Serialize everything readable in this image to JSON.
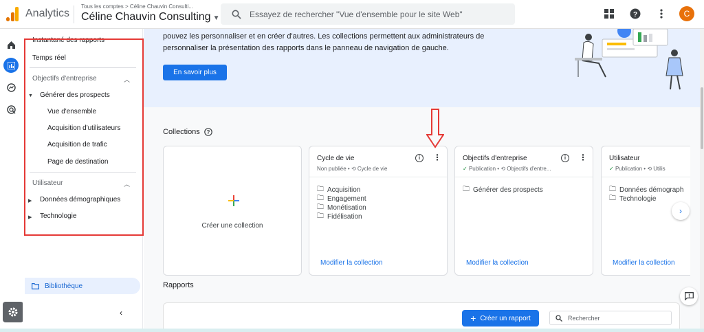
{
  "topbar": {
    "app_name": "Analytics",
    "breadcrumb": "Tous les comptes > Céline Chauvin Consulti...",
    "account": "Céline Chauvin Consulting",
    "search_placeholder": "Essayez de rechercher \"Vue d'ensemble pour le site Web\"",
    "avatar_letter": "C"
  },
  "sidebar": {
    "items": [
      {
        "label": "Instantané des rapports"
      },
      {
        "label": "Temps réel"
      }
    ],
    "sections": [
      {
        "title": "Objectifs d'entreprise",
        "groups": [
          {
            "label": "Générer des prospects",
            "expanded": true,
            "children": [
              "Vue d'ensemble",
              "Acquisition d'utilisateurs",
              "Acquisition de trafic",
              "Page de destination"
            ]
          }
        ]
      },
      {
        "title": "Utilisateur",
        "groups": [
          {
            "label": "Données démographiques",
            "expanded": false
          },
          {
            "label": "Technologie",
            "expanded": false
          }
        ]
      }
    ],
    "library": "Bibliothèque"
  },
  "hero": {
    "line1": "pouvez les personnaliser et en créer d'autres. Les collections permettent aux administrateurs de",
    "line2": "personnaliser la présentation des rapports dans le panneau de navigation de gauche.",
    "button": "En savoir plus"
  },
  "collections": {
    "title": "Collections",
    "create_label": "Créer une collection",
    "cards": [
      {
        "title": "Cycle de vie",
        "status": "Non publiée",
        "template": "Cycle de vie",
        "items": [
          "Acquisition",
          "Engagement",
          "Monétisation",
          "Fidélisation"
        ],
        "link": "Modifier la collection"
      },
      {
        "title": "Objectifs d'entreprise",
        "status": "Publication",
        "template": "Objectifs d'entre...",
        "items": [
          "Générer des prospects"
        ],
        "link": "Modifier la collection"
      },
      {
        "title": "Utilisateur",
        "status": "Publication",
        "template": "Utilis",
        "items": [
          "Données démograph",
          "Technologie"
        ],
        "link": "Modifier la collection"
      }
    ]
  },
  "reports": {
    "title": "Rapports",
    "create_button": "Créer un rapport",
    "search_placeholder": "Rechercher"
  },
  "colors": {
    "accent": "#1a73e8",
    "highlight_box": "#e53935",
    "published": "#1e8e3e"
  }
}
